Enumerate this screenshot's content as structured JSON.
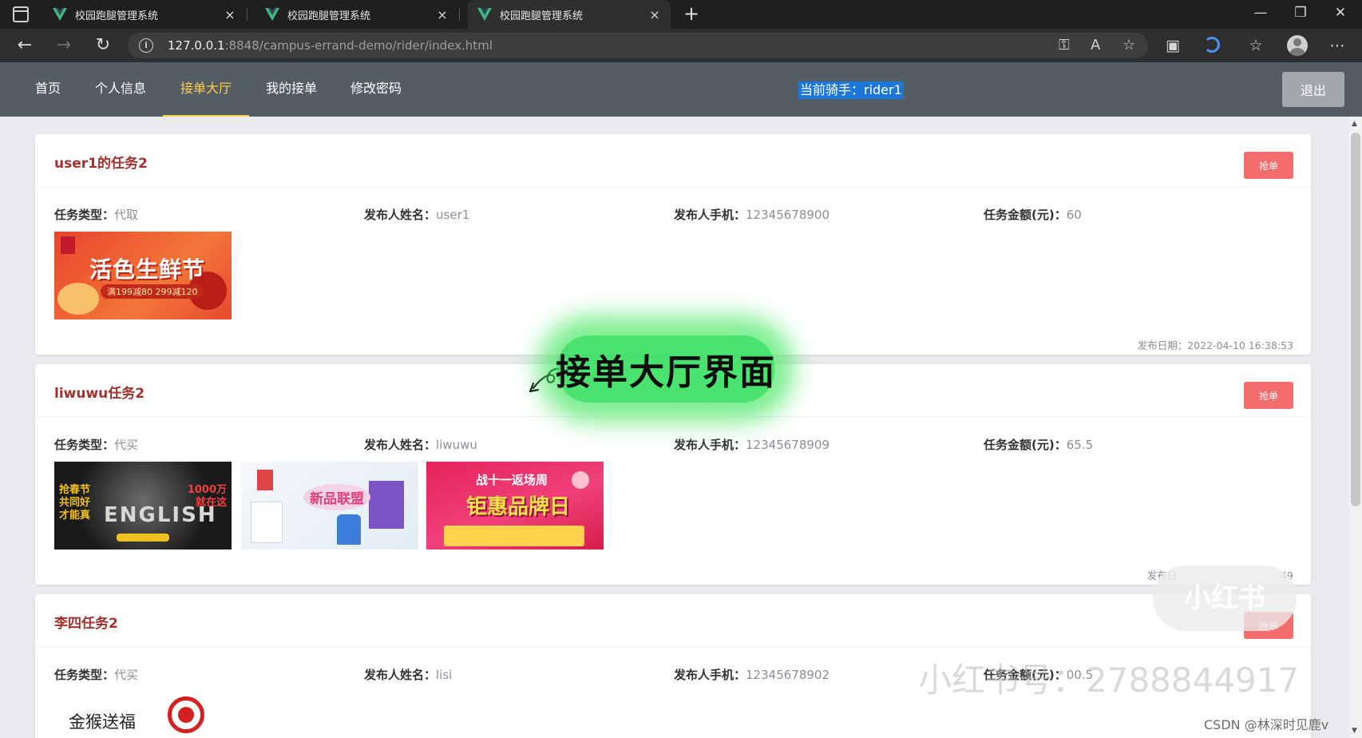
{
  "browser": {
    "tabs": [
      {
        "title": "校园跑腿管理系统",
        "close": "×"
      },
      {
        "title": "校园跑腿管理系统",
        "close": "×"
      },
      {
        "title": "校园跑腿管理系统",
        "close": "×"
      }
    ],
    "new_tab": "+",
    "window_controls": {
      "minimize": "—",
      "restore": "❐",
      "close": "✕"
    },
    "nav": {
      "back": "←",
      "forward": "→",
      "reload": "↻"
    },
    "url": {
      "host": "127.0.0.1",
      "rest": ":8848/campus-errand-demo/rider/index.html"
    }
  },
  "app": {
    "nav_items": [
      "首页",
      "个人信息",
      "接单大厅",
      "我的接单",
      "修改密码"
    ],
    "active_nav": "接单大厅",
    "current_rider": "当前骑手：rider1",
    "logout_label": "退出"
  },
  "labels": {
    "type": "任务类型：",
    "publisher": "发布人姓名：",
    "phone": "发布人手机：",
    "amount": "任务金额(元)：",
    "grab": "抢单",
    "pub_date": "发布日期："
  },
  "tasks": [
    {
      "title": "user1的任务2",
      "type": "代取",
      "publisher": "user1",
      "phone": "12345678900",
      "amount": "60",
      "images": [
        {
          "caption": "活色生鲜节",
          "sub": "满199减80 299减120"
        }
      ],
      "pub_date": "2022-04-10 16:38:53"
    },
    {
      "title": "liwuwu任务2",
      "type": "代买",
      "publisher": "liwuwu",
      "phone": "12345678909",
      "amount": "65.5",
      "images": [
        {
          "caption": "ENGLISH"
        },
        {
          "caption": "新品联盟"
        },
        {
          "caption": "钜惠品牌日",
          "sub": "战十一返场周"
        }
      ],
      "pub_date_visible": "发布日",
      "pub_date_tail": "49"
    },
    {
      "title": "李四任务2",
      "type": "代买",
      "publisher": "lisi",
      "phone": "12345678902",
      "amount_visible": "00.5",
      "images": [
        {
          "caption": "金猴送福"
        }
      ]
    }
  ],
  "overlays": {
    "banner": "接单大厅界面",
    "watermark_badge": "小红书",
    "watermark_text": "小红书号：2788844917",
    "csdn": "CSDN @林深时见鹿v"
  },
  "icons": [
    "tab-actions-icon",
    "vue-logo-icon",
    "info-icon",
    "key-icon",
    "read-aloud-icon",
    "favorite-add-icon",
    "collections-icon",
    "sync-icon",
    "favorites-icon",
    "profile-icon",
    "more-icon",
    "curved-arrow-icon"
  ],
  "colors": {
    "nav_bg": "#545c64",
    "nav_active": "#ffd04b",
    "title_red": "#a4302c",
    "grab_btn": "#f56c6c",
    "rider_highlight": "#1d77d8"
  }
}
